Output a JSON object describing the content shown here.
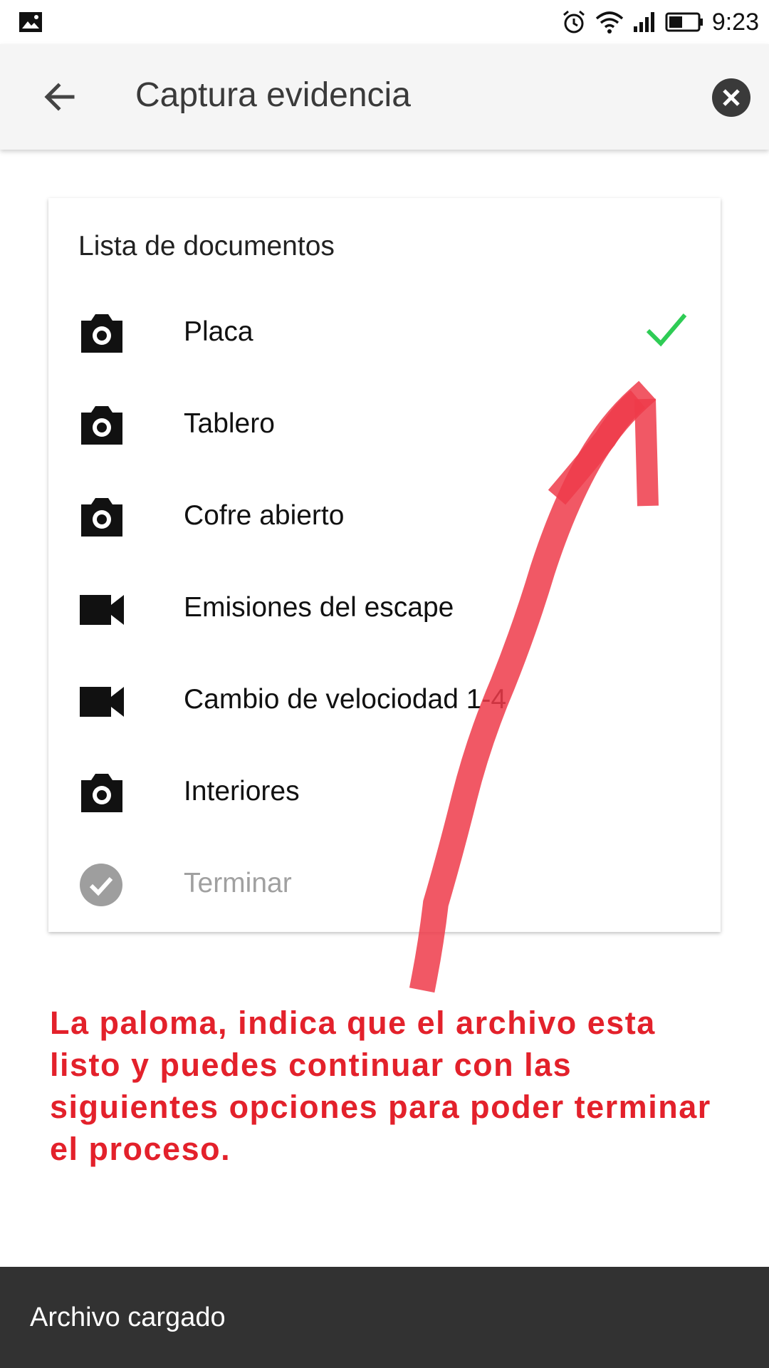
{
  "status_bar": {
    "time": "9:23",
    "icons": [
      "image-icon",
      "alarm-icon",
      "wifi-icon",
      "signal-icon",
      "battery-icon"
    ]
  },
  "app_bar": {
    "title": "Captura evidencia",
    "back_icon": "arrow-back-icon",
    "close_icon": "close-circle-icon"
  },
  "card": {
    "heading": "Lista de documentos",
    "items": [
      {
        "label": "Placa",
        "icon": "camera-icon",
        "done": true
      },
      {
        "label": "Tablero",
        "icon": "camera-icon",
        "done": false
      },
      {
        "label": "Cofre abierto",
        "icon": "camera-icon",
        "done": false
      },
      {
        "label": "Emisiones del escape",
        "icon": "videocam-icon",
        "done": false
      },
      {
        "label": "Cambio de velociodad 1-4",
        "icon": "videocam-icon",
        "done": false
      },
      {
        "label": "Interiores",
        "icon": "camera-icon",
        "done": false
      },
      {
        "label": "Terminar",
        "icon": "check-circle-icon",
        "disabled": true
      }
    ]
  },
  "annotation": {
    "text": "La paloma, indica que el archivo esta listo y puedes continuar con las siguientes opciones para poder terminar el proceso.",
    "color": "#e3212b"
  },
  "snackbar": {
    "message": "Archivo cargado"
  },
  "colors": {
    "check_green": "#2ecc55",
    "annotation_red": "#e3212b",
    "snackbar_bg": "#323232"
  }
}
